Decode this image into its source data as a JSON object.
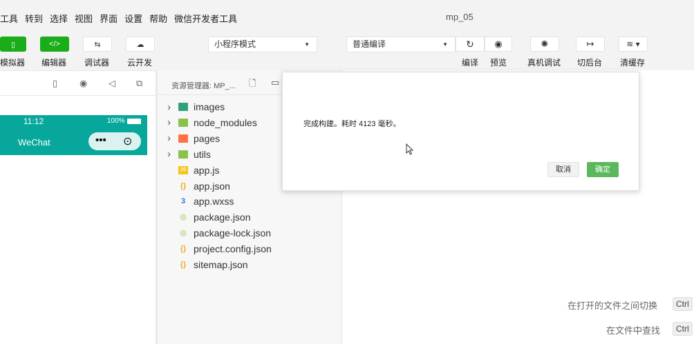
{
  "menu": [
    "工具",
    "转到",
    "选择",
    "视图",
    "界面",
    "设置",
    "帮助",
    "微信开发者工具"
  ],
  "window_title": "mp_05",
  "toolbar": {
    "simulator_label": "模拟器",
    "editor_label": "编辑器",
    "debugger_label": "调试器",
    "cloud_label": "云开发",
    "mode_select": "小程序模式",
    "compile_select": "普通编译",
    "compile_label": "编译",
    "preview_label": "预览",
    "real_debug_label": "真机调试",
    "background_label": "切后台",
    "clear_cache_label": "清缓存"
  },
  "simulator": {
    "time": "11:12",
    "battery": "100%",
    "nav_title": "WeChat"
  },
  "explorer": {
    "title": "资源管理器: MP_...",
    "files": [
      {
        "name": "images",
        "kind": "folder",
        "color": "#2ea37a"
      },
      {
        "name": "node_modules",
        "kind": "folder",
        "color": "#8bc34a"
      },
      {
        "name": "pages",
        "kind": "folder",
        "color": "#ff7043"
      },
      {
        "name": "utils",
        "kind": "folder",
        "color": "#8bc34a"
      },
      {
        "name": "app.js",
        "kind": "js",
        "color": "#f5c518"
      },
      {
        "name": "app.json",
        "kind": "json",
        "color": "#f0a92a"
      },
      {
        "name": "app.wxss",
        "kind": "css",
        "color": "#2b7bd5"
      },
      {
        "name": "package.json",
        "kind": "node",
        "color": "#8bc34a"
      },
      {
        "name": "package-lock.json",
        "kind": "node",
        "color": "#8bc34a"
      },
      {
        "name": "project.config.json",
        "kind": "json",
        "color": "#f0a92a"
      },
      {
        "name": "sitemap.json",
        "kind": "json",
        "color": "#f0a92a"
      }
    ]
  },
  "editor": {
    "hint_switch": "在打开的文件之间切换",
    "hint_find": "在文件中查找",
    "key_ctrl_1": "Ctrl",
    "key_ctrl_2": "Ctrl"
  },
  "dialog": {
    "message": "完成构建。耗时 4123 毫秒。",
    "cancel": "取消",
    "ok": "确定"
  }
}
